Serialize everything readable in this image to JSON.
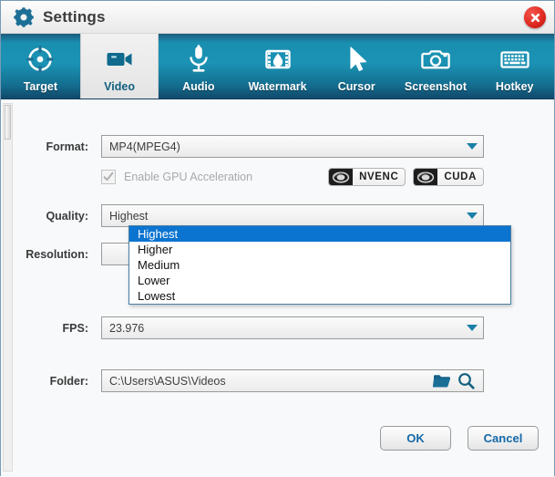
{
  "titlebar": {
    "title": "Settings",
    "gear_icon": "gear-icon",
    "close_icon": "close-icon"
  },
  "tabs": [
    {
      "label": "Target",
      "icon": "target-icon",
      "active": false
    },
    {
      "label": "Video",
      "icon": "video-camera-icon",
      "active": true
    },
    {
      "label": "Audio",
      "icon": "microphone-icon",
      "active": false
    },
    {
      "label": "Watermark",
      "icon": "watermark-icon",
      "active": false
    },
    {
      "label": "Cursor",
      "icon": "cursor-arrow-icon",
      "active": false
    },
    {
      "label": "Screenshot",
      "icon": "camera-icon",
      "active": false
    },
    {
      "label": "Hotkey",
      "icon": "keyboard-icon",
      "active": false
    }
  ],
  "form": {
    "format": {
      "label": "Format:",
      "value": "MP4(MPEG4)"
    },
    "gpu": {
      "label": "Enable GPU Acceleration",
      "checked": "checked",
      "badges": [
        {
          "text": "NVENC",
          "logo": "nvidia-eye-icon"
        },
        {
          "text": "CUDA",
          "logo": "nvidia-eye-icon"
        }
      ]
    },
    "quality": {
      "label": "Quality:",
      "value": "Highest",
      "expanded": "true",
      "options": [
        "Highest",
        "Higher",
        "Medium",
        "Lower",
        "Lowest"
      ],
      "selected_index": 0,
      "highlight_color": "#0a74d0"
    },
    "resolution": {
      "label": "Resolution:",
      "value": ""
    },
    "fps": {
      "label": "FPS:",
      "value": "23.976"
    },
    "folder": {
      "label": "Folder:",
      "value": "C:\\Users\\ASUS\\Videos",
      "browse_icon": "folder-icon",
      "search_icon": "magnifier-icon"
    }
  },
  "footer": {
    "ok": "OK",
    "cancel": "Cancel"
  },
  "colors": {
    "toolbar_teal": "#1b93b4",
    "active_tab_text": "#11607f",
    "close_red": "#e02b22",
    "button_text_blue": "#1468a8",
    "dropdown_highlight": "#0a74d0"
  }
}
